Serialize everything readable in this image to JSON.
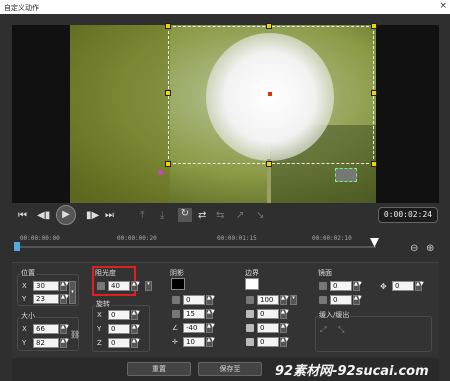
{
  "window": {
    "title": "自定义动作",
    "close": "×"
  },
  "playback": {
    "timecode": "0:00:02:24",
    "buttons": [
      "prev",
      "step-back",
      "play",
      "step-forward",
      "next"
    ]
  },
  "timeline": {
    "ticks": [
      "00:00:00:00",
      "00:00:00:20",
      "00:00:01:15",
      "00:00:02:10"
    ]
  },
  "sections": {
    "position": {
      "label": "位置",
      "x_label": "X",
      "x": "30",
      "y_label": "Y",
      "y": "23"
    },
    "size": {
      "label": "大小",
      "x_label": "X",
      "x": "66",
      "y_label": "Y",
      "y": "82"
    },
    "opacity": {
      "label": "阻光度",
      "value": "40"
    },
    "rotation": {
      "label": "旋转",
      "x_label": "X",
      "x": "0",
      "y_label": "Y",
      "y": "0",
      "z_label": "Z",
      "z": "0"
    },
    "shadow": {
      "label": "阴影",
      "v1": "0",
      "v2": "15",
      "v3": "-40",
      "v4": "10"
    },
    "border": {
      "label": "边界",
      "v1": "100",
      "v2": "0",
      "v3": "0",
      "v4": "0",
      "v5": "0"
    },
    "mirror": {
      "label": "镜面",
      "v1": "0",
      "v2": "0",
      "v3": "0"
    },
    "fade": {
      "label": "缓入/缓出"
    }
  },
  "footer": {
    "reset": "重置",
    "save": "保存至"
  },
  "watermark": "92素材网-92sucai.com"
}
